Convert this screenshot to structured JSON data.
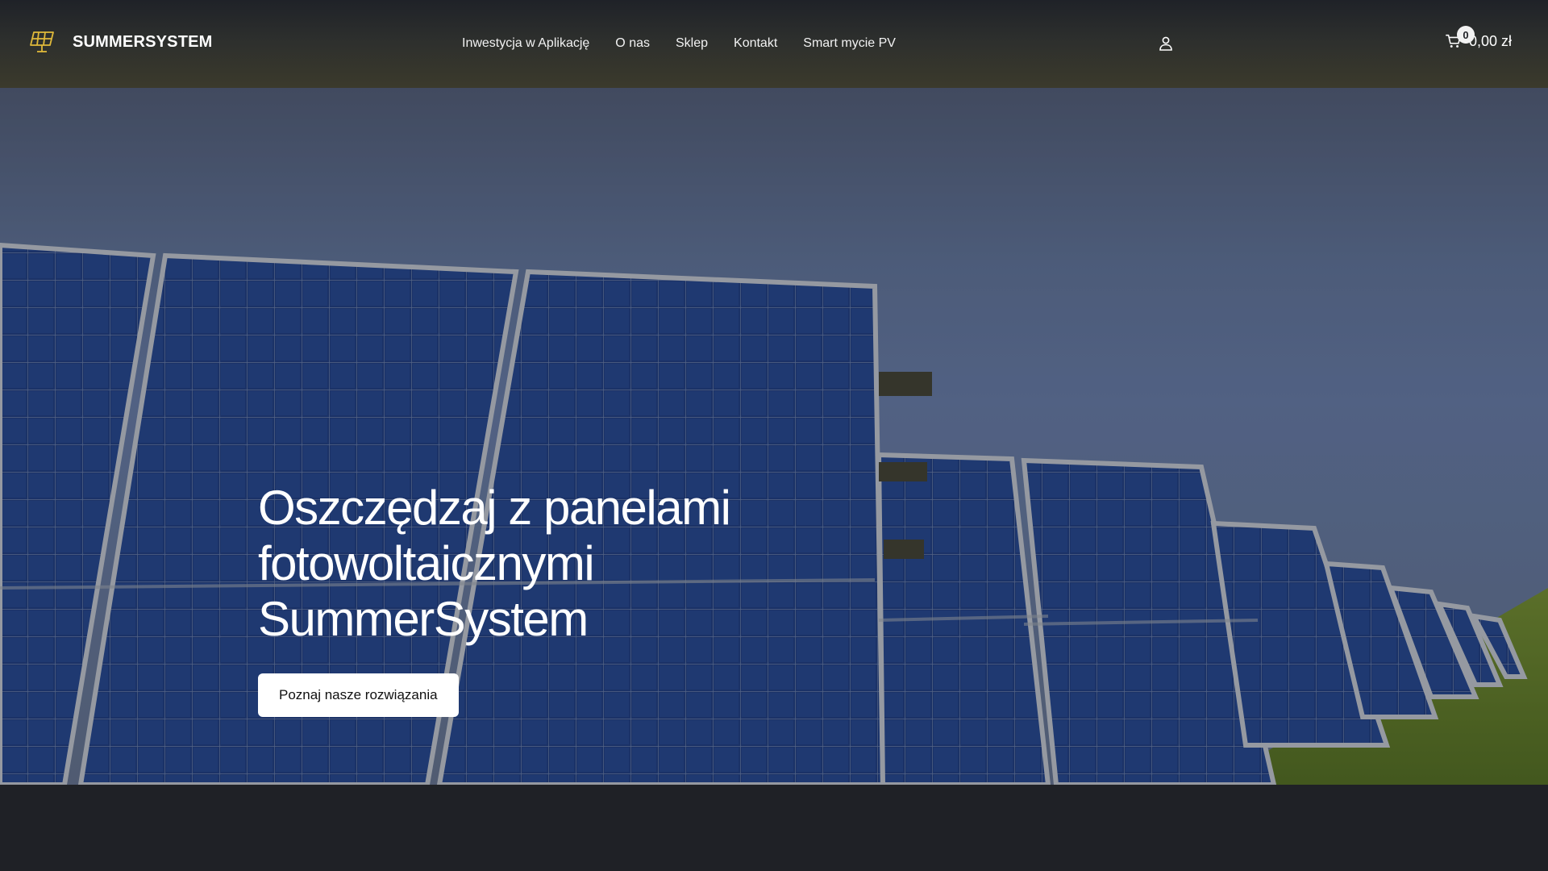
{
  "brand": {
    "name": "SUMMERSYSTEM",
    "logo_icon": "solar-panel-icon"
  },
  "nav": {
    "items": [
      {
        "label": "Inwestycja w Aplikację"
      },
      {
        "label": "O nas"
      },
      {
        "label": "Sklep"
      },
      {
        "label": "Kontakt"
      },
      {
        "label": "Smart mycie PV"
      }
    ]
  },
  "account": {
    "icon": "user-icon"
  },
  "cart": {
    "icon": "cart-icon",
    "count": "0",
    "total": "0,00 zł"
  },
  "hero": {
    "title_lines": [
      "Oszczędzaj z panelami",
      "fotowoltaicznymi",
      "SummerSystem"
    ],
    "cta_label": "Poznaj nasze rozwiązania",
    "image": "solar-panel-field-photo"
  },
  "colors": {
    "header_bg": "#2d2f2d",
    "page_bg": "#1f2126",
    "logo_accent": "#e0b93a",
    "text": "#ffffff",
    "button_bg": "#ffffff"
  }
}
